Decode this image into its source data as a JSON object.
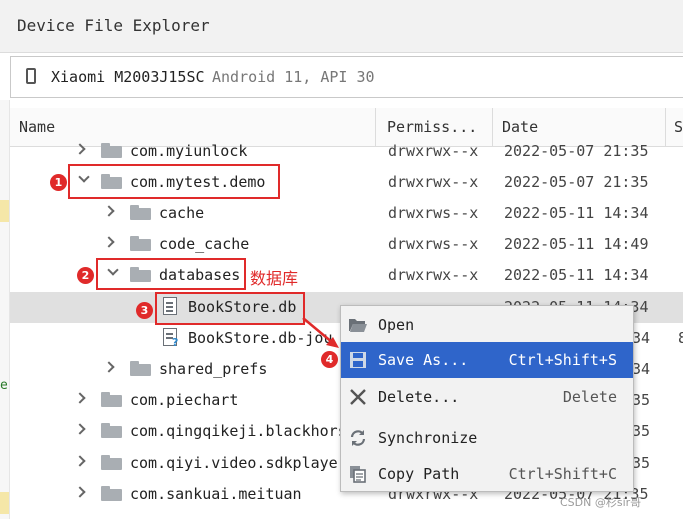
{
  "panel": {
    "title": "Device File Explorer"
  },
  "device": {
    "name": "Xiaomi M2003J15SC",
    "meta": "Android 11, API 30"
  },
  "columns": {
    "name": "Name",
    "permissions": "Permiss...",
    "date": "Date",
    "size": "S"
  },
  "rows": [
    {
      "name": "com.myiunlock",
      "perm": "drwxrwx--x",
      "date": "2022-05-07 21:35"
    },
    {
      "name": "com.mytest.demo",
      "perm": "drwxrwx--x",
      "date": "2022-05-07 21:35"
    },
    {
      "name": "cache",
      "perm": "drwxrws--x",
      "date": "2022-05-11 14:34"
    },
    {
      "name": "code_cache",
      "perm": "drwxrws--x",
      "date": "2022-05-11 14:49"
    },
    {
      "name": "databases",
      "perm": "drwxrwx--x",
      "date": "2022-05-11 14:34"
    },
    {
      "name": "BookStore.db",
      "perm": "",
      "date": "2022-05-11 14:34"
    },
    {
      "name": "BookStore.db-jou",
      "perm": "",
      "date": "34",
      "size": "8"
    },
    {
      "name": "shared_prefs",
      "perm": "",
      "date": "34"
    },
    {
      "name": "com.piechart",
      "perm": "",
      "date": "35"
    },
    {
      "name": "com.qingqikeji.blackhors",
      "perm": "",
      "date": "35"
    },
    {
      "name": "com.qiyi.video.sdkplaye",
      "perm": "",
      "date": "35"
    },
    {
      "name": "com.sankuai.meituan",
      "perm": "drwxrwx--x",
      "date": "2022-05-07 21:35"
    }
  ],
  "annotations": {
    "label_databases": "数据库",
    "b1": "1",
    "b2": "2",
    "b3": "3",
    "b4": "4"
  },
  "menu": [
    {
      "label": "Open",
      "shortcut": "",
      "icon": "folder-open-icon"
    },
    {
      "label": "Save As...",
      "shortcut": "Ctrl+Shift+S",
      "icon": "save-icon"
    },
    {
      "label": "Delete...",
      "shortcut": "Delete",
      "icon": "delete-x-icon"
    },
    {
      "label": "Synchronize",
      "shortcut": "",
      "icon": "sync-icon"
    },
    {
      "label": "Copy Path",
      "shortcut": "Ctrl+Shift+C",
      "icon": "copy-icon"
    }
  ],
  "watermark": "CSDN @杉sir哥",
  "colors": {
    "highlight": "#2f65ca",
    "annotation": "#e02a2a",
    "selected_row": "#e0e0e0"
  }
}
